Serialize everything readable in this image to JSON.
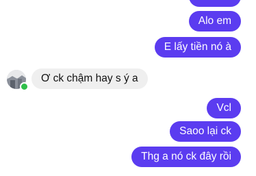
{
  "colors": {
    "outgoing_bubble": "#5b3cf0",
    "incoming_bubble": "#efefef",
    "online_indicator": "#2fbf4a"
  },
  "contact": {
    "avatar_icon": "profile-photo",
    "online": true
  },
  "messages": [
    {
      "direction": "outgoing",
      "text": ""
    },
    {
      "direction": "outgoing",
      "text": "Alo em"
    },
    {
      "direction": "outgoing",
      "text": "E lấy tiền nó à"
    },
    {
      "direction": "incoming",
      "text": "Ơ ck chậm hay s ý a"
    },
    {
      "direction": "outgoing",
      "text": "Vcl"
    },
    {
      "direction": "outgoing",
      "text": "Saoo lại ck"
    },
    {
      "direction": "outgoing",
      "text": "Thg a nó ck đây rồi"
    }
  ]
}
